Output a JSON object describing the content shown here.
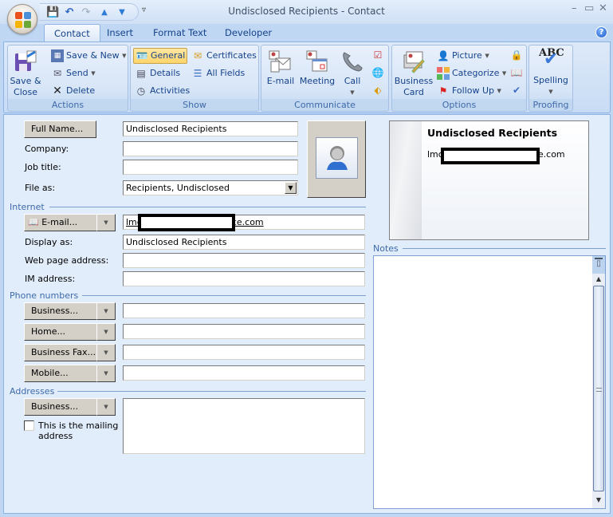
{
  "window": {
    "title": "Undisclosed Recipients - Contact",
    "controls": [
      "minimize",
      "maximize",
      "close"
    ]
  },
  "quick_access": [
    "save-icon",
    "undo-icon",
    "redo-icon",
    "previous-item-icon",
    "next-item-icon",
    "customize-icon"
  ],
  "tabs": [
    {
      "label": "Contact",
      "active": true
    },
    {
      "label": "Insert",
      "active": false
    },
    {
      "label": "Format Text",
      "active": false
    },
    {
      "label": "Developer",
      "active": false
    }
  ],
  "ribbon": {
    "actions": {
      "label": "Actions",
      "save_close": "Save &\nClose",
      "save_close_l1": "Save &",
      "save_close_l2": "Close",
      "save_new": "Save & New",
      "send": "Send",
      "delete": "Delete"
    },
    "show": {
      "label": "Show",
      "general": "General",
      "details": "Details",
      "activities": "Activities",
      "certificates": "Certificates",
      "all_fields": "All Fields"
    },
    "communicate": {
      "label": "Communicate",
      "email": "E-mail",
      "meeting": "Meeting",
      "call": "Call"
    },
    "options": {
      "label": "Options",
      "business_card_l1": "Business",
      "business_card_l2": "Card",
      "picture": "Picture",
      "categorize": "Categorize",
      "follow_up": "Follow Up"
    },
    "proofing": {
      "label": "Proofing",
      "spelling": "Spelling",
      "abc": "ABC"
    }
  },
  "form": {
    "full_name_btn": "Full Name...",
    "full_name": "Undisclosed Recipients",
    "company_label": "Company:",
    "company": "",
    "job_title_label": "Job title:",
    "job_title": "",
    "file_as_label": "File as:",
    "file_as": "Recipients, Undisclosed",
    "internet_section": "Internet",
    "email_btn": "E-mail...",
    "email_prefix": "lmc",
    "email_suffix": "ce.com",
    "display_as_label": "Display as:",
    "display_as": "Undisclosed Recipients",
    "web_label": "Web page address:",
    "web": "",
    "im_label": "IM address:",
    "im": "",
    "phone_section": "Phone numbers",
    "phones": [
      {
        "label": "Business...",
        "value": ""
      },
      {
        "label": "Home...",
        "value": ""
      },
      {
        "label": "Business Fax...",
        "value": ""
      },
      {
        "label": "Mobile...",
        "value": ""
      }
    ],
    "addresses_section": "Addresses",
    "address_btn": "Business...",
    "address": "",
    "mailing_checkbox_l1": "This is the mailing",
    "mailing_checkbox_l2": "address",
    "mailing_checked": false
  },
  "business_card": {
    "name": "Undisclosed Recipients",
    "email_prefix": "lmc",
    "email_suffix": "ce.com"
  },
  "notes": {
    "label": "Notes",
    "value": ""
  }
}
